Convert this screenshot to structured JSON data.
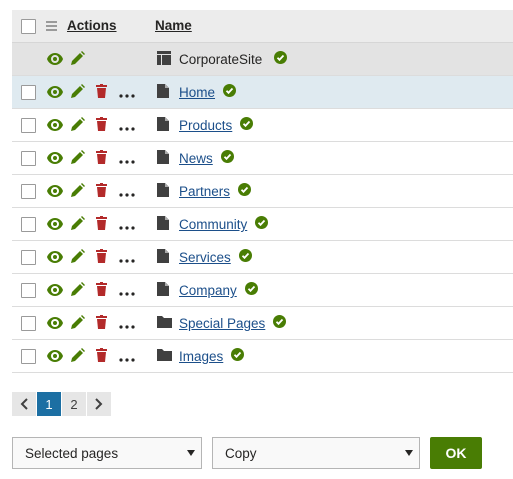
{
  "header": {
    "actions_label": "Actions",
    "name_label": "Name"
  },
  "root": {
    "name": "CorporateSite"
  },
  "rows": [
    {
      "name": "Home",
      "type": "page"
    },
    {
      "name": "Products",
      "type": "page"
    },
    {
      "name": "News",
      "type": "page"
    },
    {
      "name": "Partners",
      "type": "page"
    },
    {
      "name": "Community",
      "type": "page"
    },
    {
      "name": "Services",
      "type": "page"
    },
    {
      "name": "Company",
      "type": "page"
    },
    {
      "name": "Special Pages",
      "type": "folder"
    },
    {
      "name": "Images",
      "type": "folder"
    }
  ],
  "pager": {
    "pages": [
      "1",
      "2"
    ],
    "active": "1"
  },
  "footer": {
    "scope_select": "Selected pages",
    "action_select": "Copy",
    "ok_label": "OK"
  },
  "colors": {
    "green": "#497d04",
    "red": "#b32a2a",
    "link": "#1c4f8a",
    "active_page": "#1c6fa3",
    "hover_row": "#dfeaf0"
  }
}
